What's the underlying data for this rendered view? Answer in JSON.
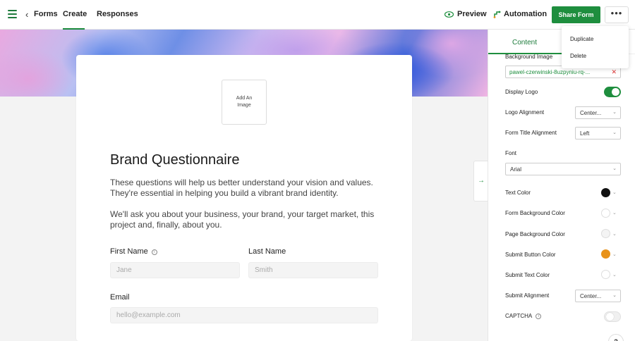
{
  "topbar": {
    "forms_label": "Forms",
    "create_label": "Create",
    "responses_label": "Responses",
    "preview_label": "Preview",
    "automation_label": "Automation",
    "share_label": "Share Form",
    "more_label": "•••"
  },
  "menu": {
    "items": [
      "Duplicate",
      "Delete"
    ]
  },
  "form": {
    "logo_placeholder": "Add An Image",
    "title": "Brand Questionnaire",
    "description1": "These questions will help us better understand your vision and values. They're essential in helping you build a vibrant brand identity.",
    "description2": "We'll ask you about your business, your brand, your target market, this project and, finally, about you.",
    "fields": {
      "first_name": {
        "label": "First Name",
        "placeholder": "Jane"
      },
      "last_name": {
        "label": "Last Name",
        "placeholder": "Smith"
      },
      "email": {
        "label": "Email",
        "placeholder": "hello@example.com"
      }
    }
  },
  "panel": {
    "tab_content": "Content",
    "background_image_label": "Background Image",
    "background_image_value": "pawel-czerwinski-8uzpyniu-rq-...",
    "display_logo_label": "Display Logo",
    "display_logo_on": true,
    "logo_alignment_label": "Logo Alignment",
    "logo_alignment_value": "Center...",
    "title_alignment_label": "Form Title Alignment",
    "title_alignment_value": "Left",
    "font_label": "Font",
    "font_value": "Arial",
    "text_color_label": "Text Color",
    "form_bg_color_label": "Form Background Color",
    "page_bg_color_label": "Page Background Color",
    "submit_button_color_label": "Submit Button Color",
    "submit_text_color_label": "Submit Text Color",
    "submit_alignment_label": "Submit Alignment",
    "submit_alignment_value": "Center...",
    "captcha_label": "CAPTCHA",
    "captcha_on": false,
    "help_label": "?"
  },
  "colors": {
    "accent": "#1e8e3e",
    "text_color": "#111111",
    "form_bg_color": "#ffffff",
    "page_bg_color": "#f4f4f4",
    "submit_button_color": "#e8921a",
    "submit_text_color": "#ffffff"
  }
}
